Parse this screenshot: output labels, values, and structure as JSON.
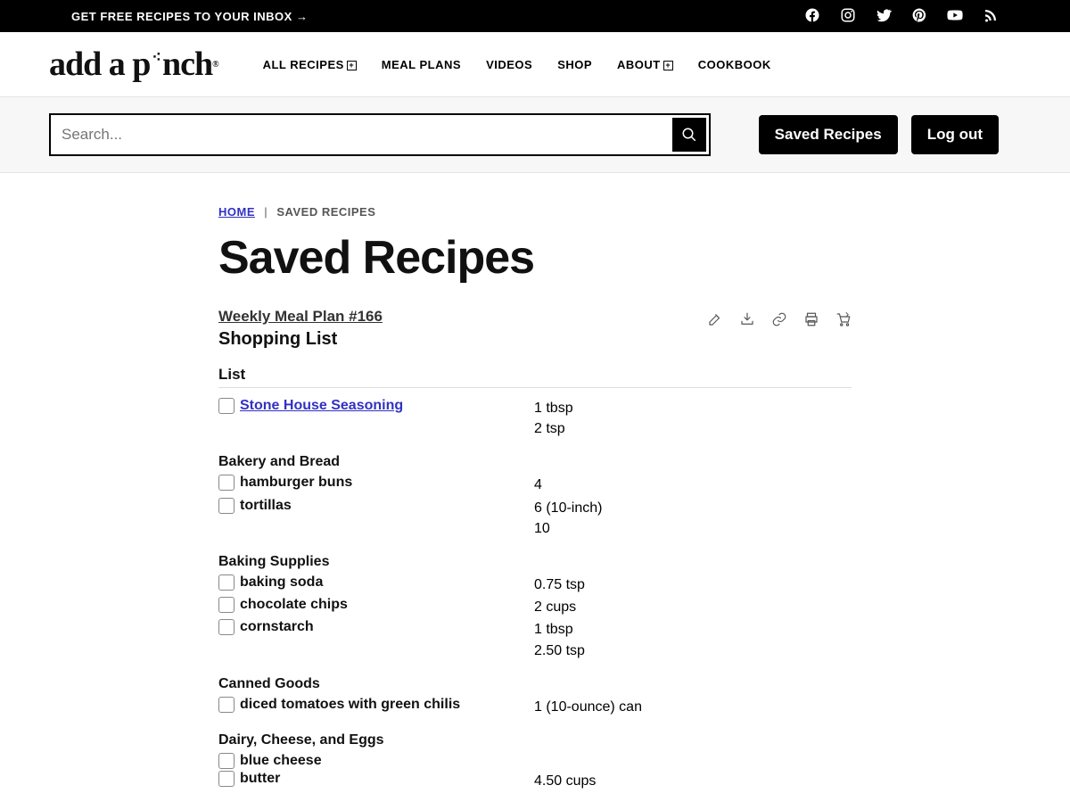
{
  "topbar": {
    "cta": "GET FREE RECIPES TO YOUR INBOX →"
  },
  "nav": {
    "logo_a": "add a p",
    "logo_b": "nch",
    "logo_reg": "®",
    "links": [
      "ALL RECIPES",
      "MEAL PLANS",
      "VIDEOS",
      "SHOP",
      "ABOUT",
      "COOKBOOK"
    ]
  },
  "search": {
    "placeholder": "Search...",
    "saved_btn": "Saved Recipes",
    "logout_btn": "Log out"
  },
  "breadcrumb": {
    "home": "HOME",
    "current": "SAVED RECIPES"
  },
  "page_title": "Saved Recipes",
  "meal_plan_link": "Weekly Meal Plan #166",
  "shopping_list_title": "Shopping List",
  "section_label": "List",
  "categories": [
    {
      "heading": null,
      "items": [
        {
          "name": "Stone House Seasoning",
          "link": true,
          "qty": [
            "1 tbsp",
            "2 tsp"
          ]
        }
      ]
    },
    {
      "heading": "Bakery and Bread",
      "items": [
        {
          "name": "hamburger buns",
          "link": false,
          "qty": [
            "4"
          ]
        },
        {
          "name": "tortillas",
          "link": false,
          "qty": [
            "6 (10-inch)",
            "10"
          ]
        }
      ]
    },
    {
      "heading": "Baking Supplies",
      "items": [
        {
          "name": "baking soda",
          "link": false,
          "qty": [
            "0.75 tsp"
          ]
        },
        {
          "name": "chocolate chips",
          "link": false,
          "qty": [
            "2 cups"
          ]
        },
        {
          "name": "cornstarch",
          "link": false,
          "qty": [
            "1 tbsp",
            "2.50 tsp"
          ]
        }
      ]
    },
    {
      "heading": "Canned Goods",
      "items": [
        {
          "name": "diced tomatoes with green chilis",
          "link": false,
          "qty": [
            "1 (10-ounce) can"
          ]
        }
      ]
    },
    {
      "heading": "Dairy, Cheese, and Eggs",
      "items": [
        {
          "name": "blue cheese",
          "link": false,
          "qty": [
            ""
          ]
        },
        {
          "name": "butter",
          "link": false,
          "qty": [
            "4.50 cups"
          ]
        }
      ]
    }
  ]
}
